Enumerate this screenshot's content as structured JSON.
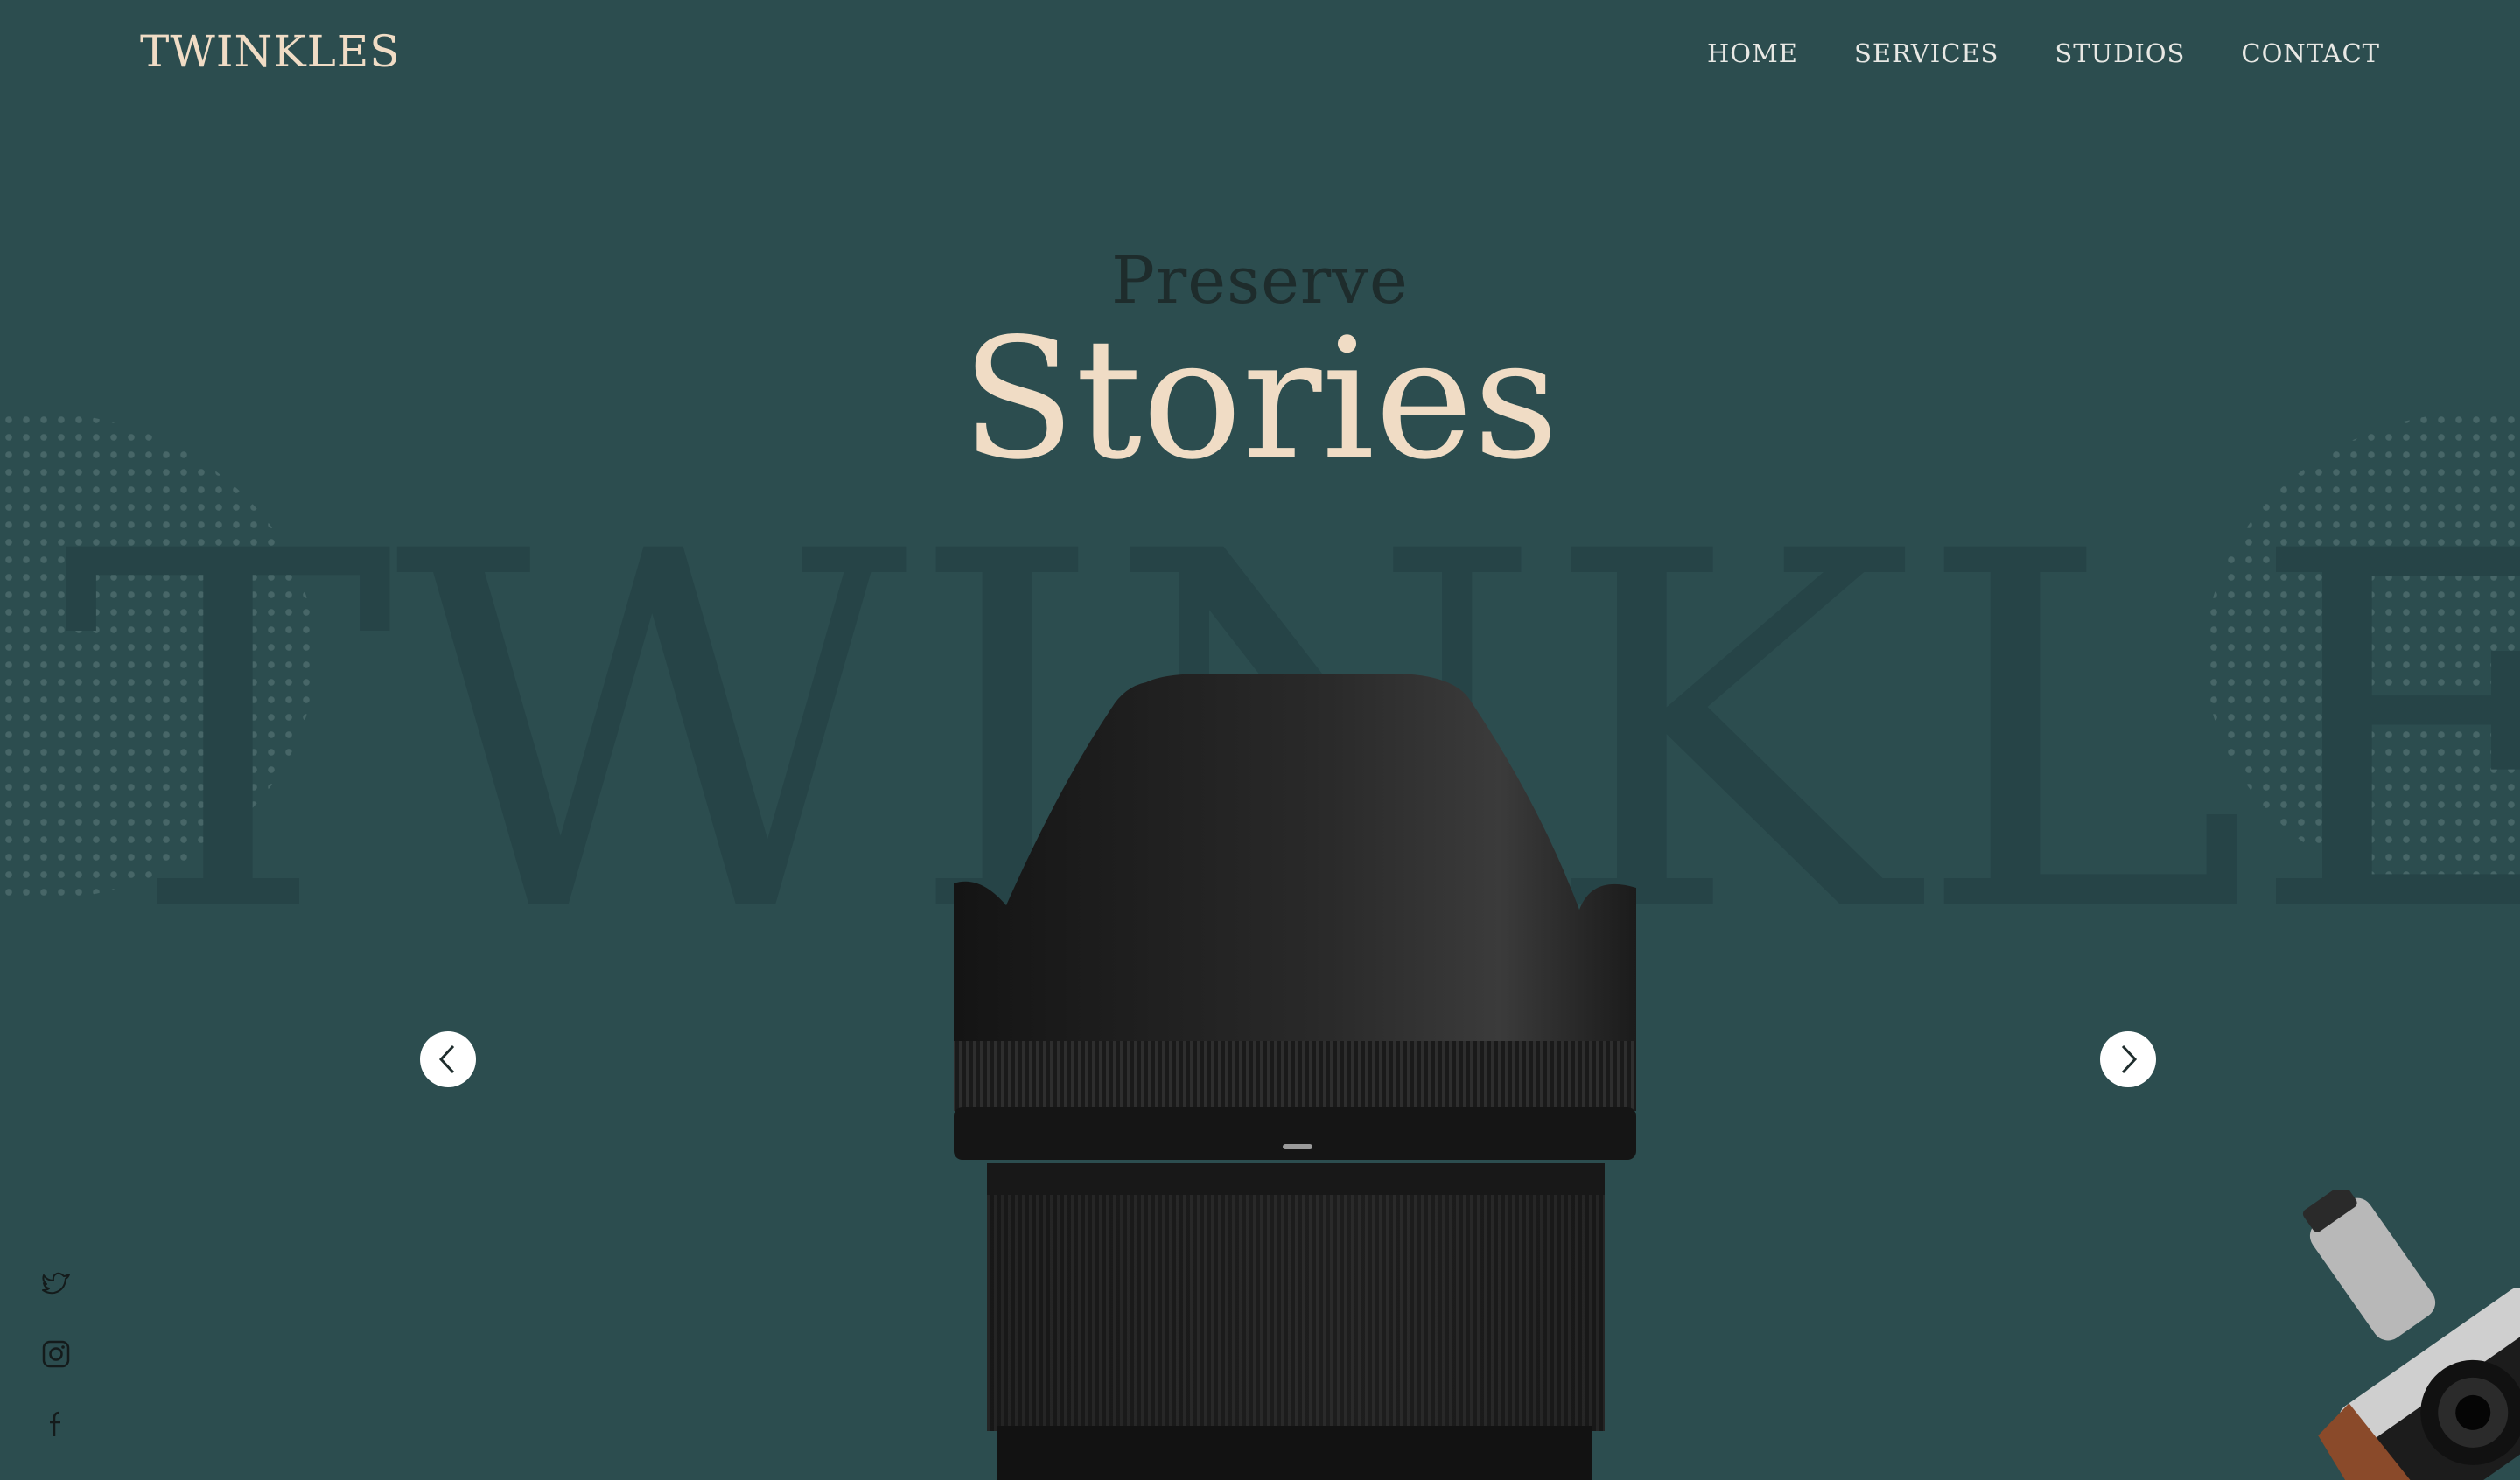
{
  "header": {
    "logo": "TWINKLES",
    "nav": [
      "HOME",
      "SERVICES",
      "STUDIOS",
      "CONTACT"
    ]
  },
  "hero": {
    "pre_title": "Preserve",
    "title": "Stories",
    "watermark": "TWINKLES"
  },
  "slider": {
    "prev_icon": "chevron-left-icon",
    "next_icon": "chevron-right-icon"
  },
  "social": [
    "twitter-icon",
    "instagram-icon",
    "facebook-icon"
  ],
  "colors": {
    "background": "#2c4d4f",
    "accent": "#f0dcc5",
    "dark_text": "#1e2c2c",
    "nav_text": "#e8e8e4"
  }
}
